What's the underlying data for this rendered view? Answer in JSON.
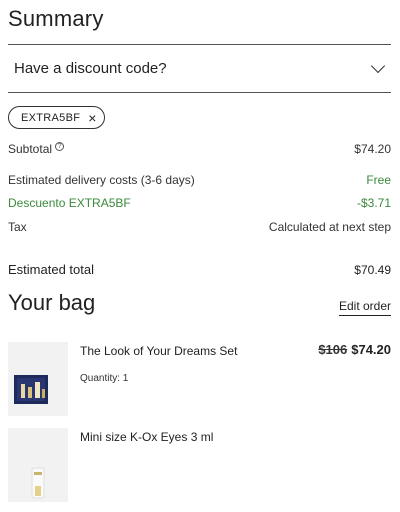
{
  "summary": {
    "title": "Summary"
  },
  "discount": {
    "toggle_label": "Have a discount code?",
    "applied_code": "EXTRA5BF",
    "remove_symbol": "×"
  },
  "lines": [
    {
      "label": "Subtotal",
      "value": "$74.20",
      "help": "?"
    },
    {
      "label": "Estimated delivery costs (3-6 days)",
      "value": "Free"
    },
    {
      "label": "Descuento EXTRA5BF",
      "value": "-$3.71"
    },
    {
      "label": "Tax",
      "value": "Calculated at next step"
    }
  ],
  "total": {
    "label": "Estimated total",
    "value": "$70.49"
  },
  "bag": {
    "title": "Your bag",
    "edit_label": "Edit order",
    "items": [
      {
        "name": "The Look of Your Dreams Set",
        "quantity_label": "Quantity: 1",
        "original_price": "$106",
        "price": "$74.20"
      },
      {
        "name": "Mini size K-Ox Eyes 3 ml"
      }
    ]
  },
  "colors": {
    "discount_green": "#3a8a3a",
    "text": "#222222"
  }
}
